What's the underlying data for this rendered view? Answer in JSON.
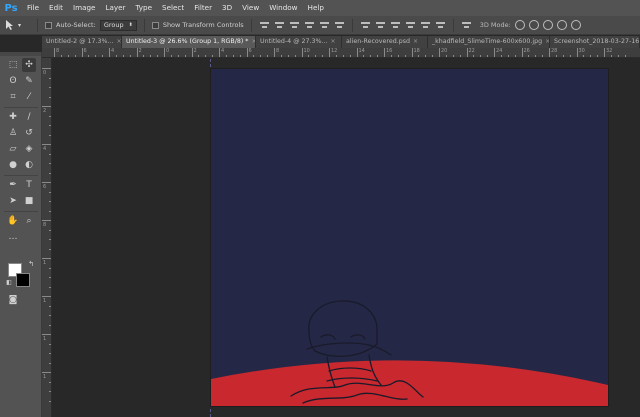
{
  "app": {
    "logo": "Ps"
  },
  "menu": [
    "File",
    "Edit",
    "Image",
    "Layer",
    "Type",
    "Select",
    "Filter",
    "3D",
    "View",
    "Window",
    "Help"
  ],
  "options": {
    "tool_icon": "move-tool-icon",
    "auto_select_label": "Auto-Select:",
    "auto_select_value": "Group",
    "show_transform_label": "Show Transform Controls",
    "mode_3d_label": "3D Mode:"
  },
  "tabs": [
    {
      "label": "Untitled-2 @ 17.3%...",
      "active": false
    },
    {
      "label": "Untitled-3 @ 26.6% (Group 1, RGB/8) *",
      "active": true
    },
    {
      "label": "Untitled-4 @ 27.3%...",
      "active": false
    },
    {
      "label": "alien-Recovered.psd",
      "active": false
    },
    {
      "label": "_khadfield_SlimeTime-600x600.jpg",
      "active": false
    },
    {
      "label": "Screenshot_2018-03-27-16-16",
      "active": false
    }
  ],
  "ruler_top_labels": [
    "8",
    "6",
    "4",
    "2",
    "0",
    "2",
    "4",
    "6",
    "8",
    "10",
    "12",
    "14",
    "16",
    "18",
    "20",
    "22",
    "24",
    "26",
    "28",
    "30",
    "32"
  ],
  "ruler_left_labels": [
    "0",
    "2",
    "4",
    "6",
    "8",
    "1",
    "1",
    "1",
    "1"
  ],
  "canvas": {
    "background_color": "#242846",
    "ground_color": "#c8282e",
    "line_color": "#1a1a2a"
  },
  "swatches": {
    "foreground": "#ffffff",
    "background": "#000000"
  }
}
